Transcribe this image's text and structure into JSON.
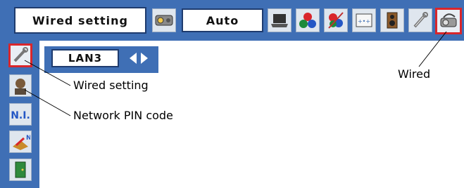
{
  "top_menu": {
    "title": "Wired setting",
    "mode_value": "Auto"
  },
  "submenu": {
    "value": "LAN3"
  },
  "callouts": {
    "wired_setting": "Wired setting",
    "network_pin": "Network PIN code",
    "wired": "Wired"
  },
  "colors": {
    "menu_blue": "#3f6fb5",
    "selected_border": "#d9262b"
  },
  "icons": [
    "projector-icon",
    "laptop-icon",
    "color-balls-icon",
    "color-adjust-icon",
    "screen-icon",
    "speaker-icon",
    "wrench-icon",
    "network-projector-icon"
  ],
  "sidebar_icons": [
    "wrench-icon",
    "person-icon",
    "network-info-icon",
    "network-pin-icon",
    "exit-icon"
  ]
}
